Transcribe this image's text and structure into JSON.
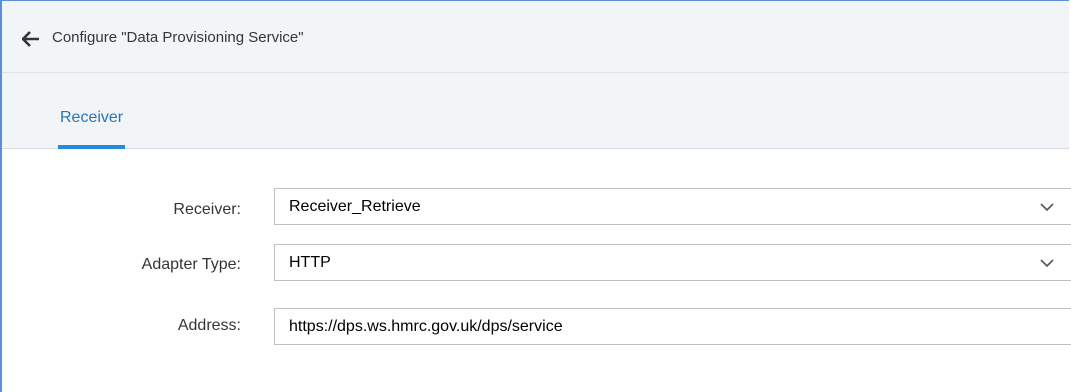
{
  "header": {
    "back_icon": "arrow-left-icon",
    "title": "Configure \"Data Provisioning Service\""
  },
  "tabs": [
    {
      "label": "Receiver",
      "selected": true
    }
  ],
  "form": {
    "receiver": {
      "label": "Receiver:",
      "value": "Receiver_Retrieve",
      "icon": "chevron-down-icon"
    },
    "adapter_type": {
      "label": "Adapter Type:",
      "value": "HTTP",
      "icon": "chevron-down-icon"
    },
    "address": {
      "label": "Address:",
      "value": "https://dps.ws.hmrc.gov.uk/dps/service"
    }
  },
  "colors": {
    "accent": "#1f8ce0",
    "tab_text": "#2a74b5",
    "header_bg": "#f2f5f8",
    "frame_border": "#5b8fd6"
  }
}
